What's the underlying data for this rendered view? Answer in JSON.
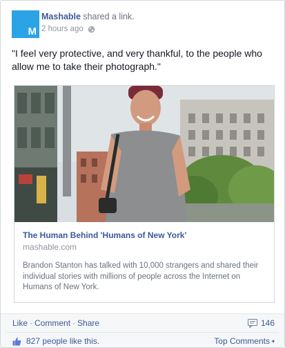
{
  "post": {
    "author": "Mashable",
    "action_text": "shared a link.",
    "timestamp": "2 hours ago",
    "avatar_letter": "M",
    "message": "\"I feel very protective, and very thankful, to the people who allow me to take their photograph.\""
  },
  "attachment": {
    "title": "The Human Behind 'Humans of New York'",
    "domain": "mashable.com",
    "description": "Brandon Stanton has talked with 10,000 strangers and shared their individual stories with millions of people across the Internet on Humans of New York."
  },
  "footer": {
    "like_label": "Like",
    "comment_label": "Comment",
    "share_label": "Share",
    "separator": "·",
    "comment_count": "146",
    "likes_text": "827 people like this.",
    "top_comments_label": "Top Comments",
    "top_comments_chevron": "▾"
  },
  "colors": {
    "link_blue": "#3b5998",
    "avatar_blue": "#2aa4e4",
    "muted_gray": "#90949c",
    "footer_bg": "#f6f7f9"
  },
  "icons": [
    "globe-icon",
    "comment-icon",
    "like-thumb-icon",
    "chevron-down-icon"
  ]
}
